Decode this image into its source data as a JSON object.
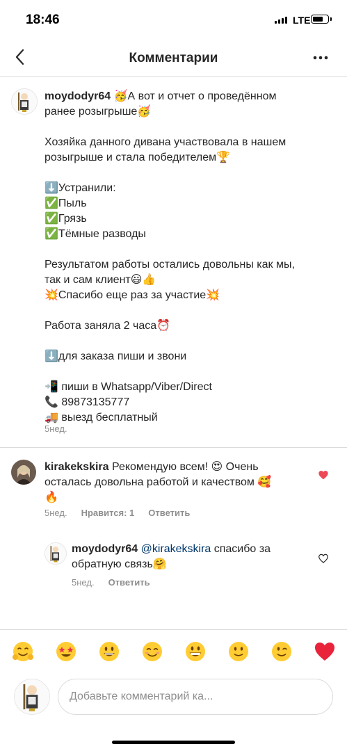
{
  "status_bar": {
    "time": "18:46",
    "network": "LTE"
  },
  "header": {
    "title": "Комментарии"
  },
  "post": {
    "username": "moydodyr64",
    "lines": [
      "🥳А вот и отчет о проведённом",
      "ранее розыгрыше🥳",
      "",
      "Хозяйка данного дивана участвовала в нашем",
      "розыгрыше и стала победителем🏆",
      "",
      "⬇️Устранили:",
      "✅Пыль",
      "✅Грязь",
      "✅Тёмные разводы",
      "",
      "Результатом работы остались довольны как мы,",
      "так и сам клиент😃👍",
      "💥Спасибо еще раз за участие💥",
      "",
      "Работа заняла 2 часа⏰",
      "",
      "⬇️для заказа пиши и звони",
      "",
      "📲 пиши в Whatsapp/Viber/Direct",
      "📞 89873135777",
      "🚚 выезд бесплатный"
    ],
    "time": "5нед."
  },
  "comment": {
    "username": "kirakekskira",
    "line1": " Рекомендую всем! 😍 Очень",
    "line2": "осталась довольна работой и качеством 🥰",
    "line3": "🔥",
    "time": "5нед.",
    "likes": "Нравится: 1",
    "reply_label": "Ответить",
    "liked": true
  },
  "reply": {
    "username": "moydodyr64",
    "mention": "@kirakekskira",
    "line1_rest": " спасибо за",
    "line2": "обратную связь🤗",
    "time": "5нед.",
    "reply_label": "Ответить"
  },
  "emoji_bar": [
    "🤗",
    "🤩",
    "😃",
    "😊",
    "😀",
    "🙂",
    "😉",
    "❤️"
  ],
  "compose": {
    "placeholder": "Добавьте комментарий ка..."
  }
}
